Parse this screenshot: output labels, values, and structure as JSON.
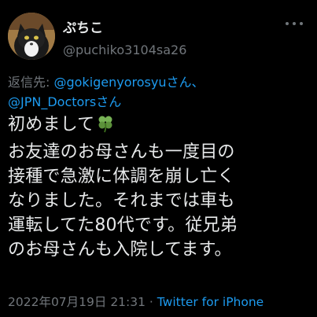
{
  "tweet": {
    "display_name": "ぷちこ",
    "handle": "@puchiko3104sa26",
    "reply_prefix": "返信先: ",
    "reply_to_1": "@gokigenyorosyu",
    "reply_sep": "さん、",
    "reply_to_2": "@JPN_Doctors",
    "reply_suffix": "さん",
    "text_lines": [
      "初めまして",
      "お友達のお母さんも一度目の",
      "接種で急激に体調を崩し亡く",
      "なりました。それまでは車も",
      "運転してた80代です。従兄弟",
      "のお母さんも入院してます。"
    ],
    "emoji": "four-leaf-clover",
    "timestamp": "2022年07月19日 21:31",
    "meta_sep": " · ",
    "source": "Twitter for iPhone"
  },
  "colors": {
    "background": "#000000",
    "text": "#e7e9ea",
    "secondary": "#71767b",
    "link": "#1d9bf0"
  },
  "icons": [
    "more-icon",
    "four-leaf-clover-icon"
  ]
}
